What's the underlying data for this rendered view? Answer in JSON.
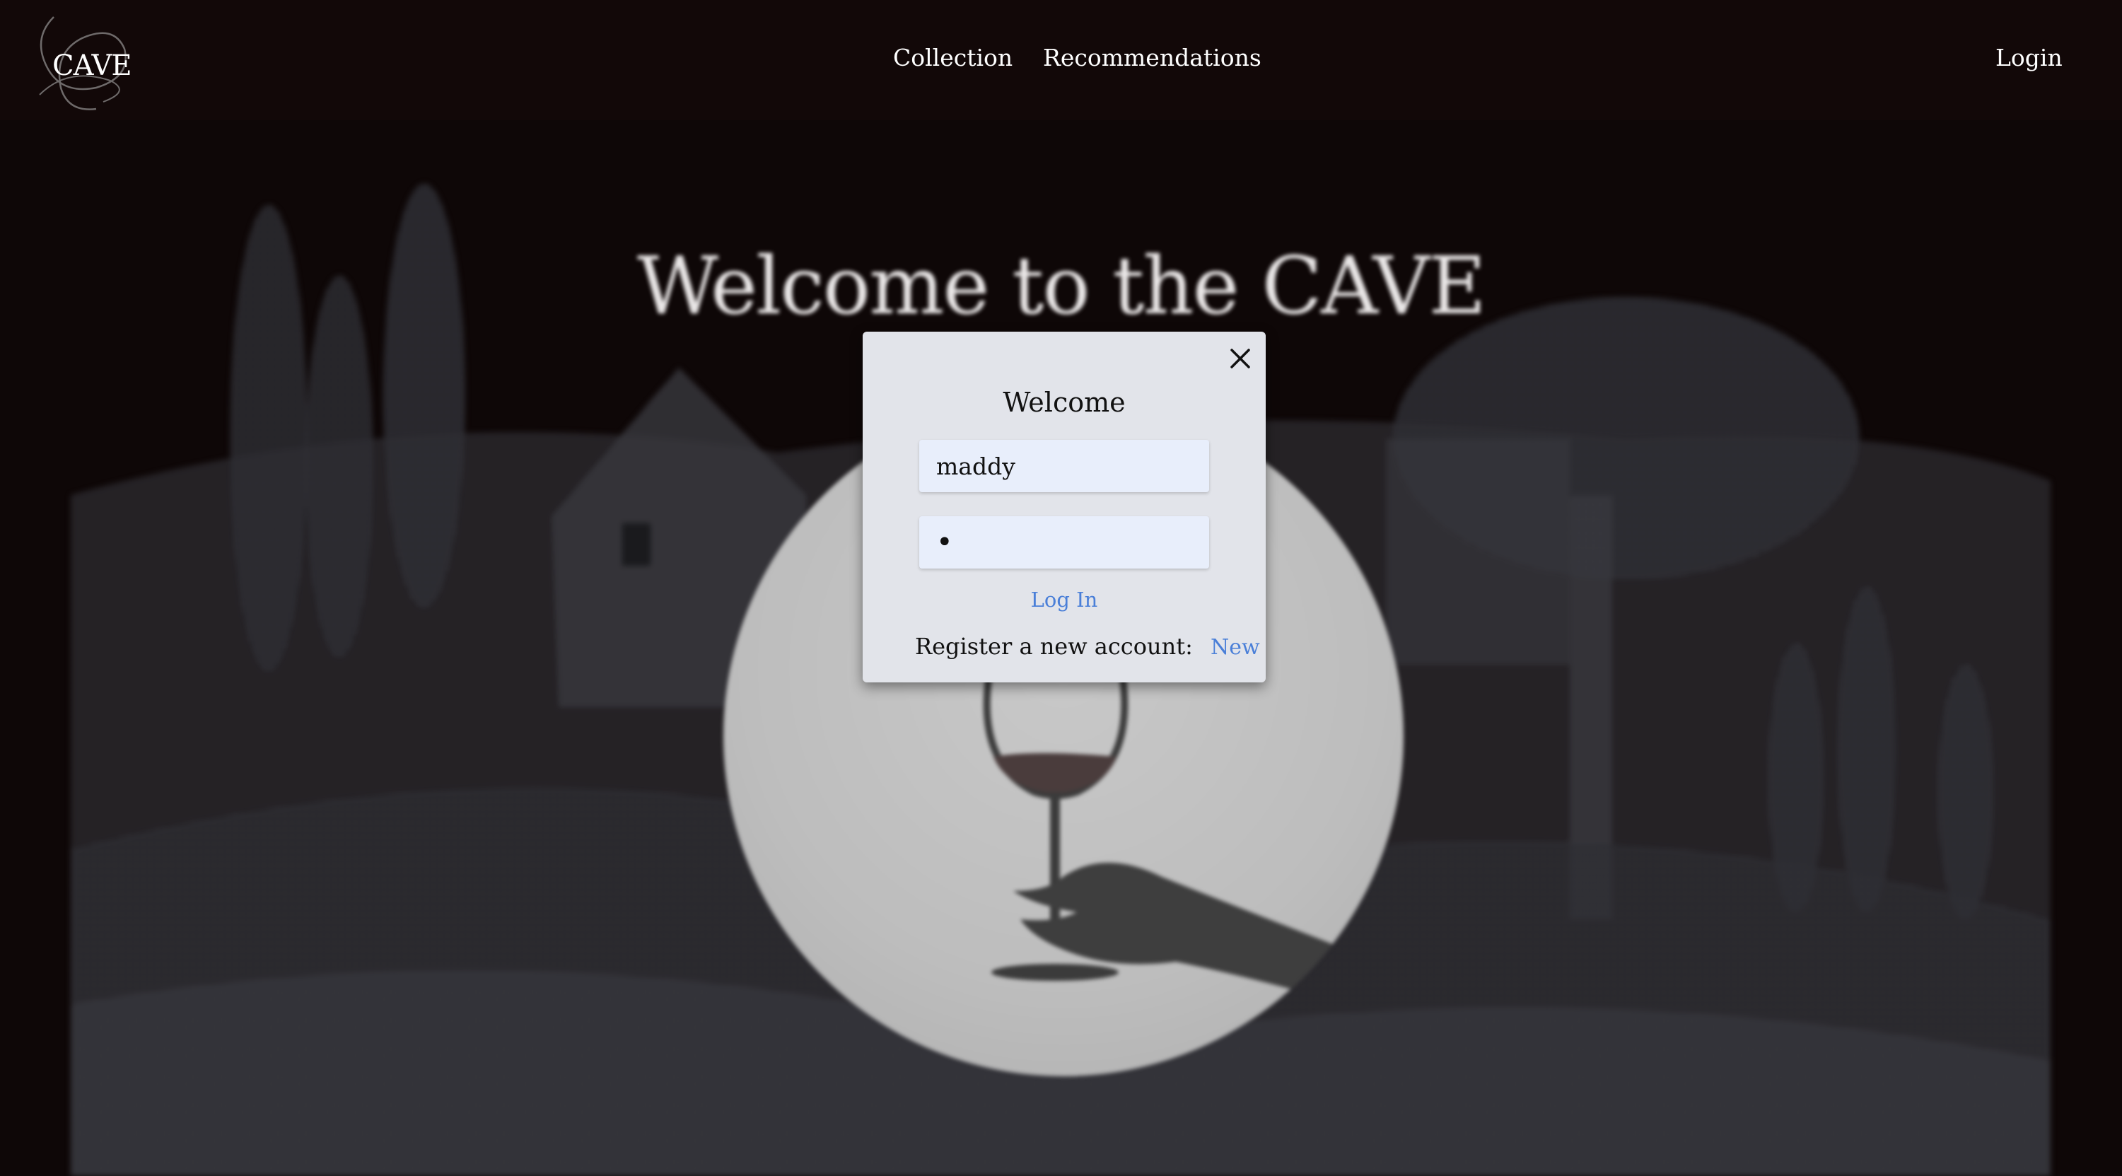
{
  "header": {
    "logo_text": "CAVE",
    "nav": {
      "collection": "Collection",
      "recommendations": "Recommendations",
      "login": "Login"
    }
  },
  "hero": {
    "title": "Welcome to the CAVE"
  },
  "modal": {
    "title": "Welcome",
    "username_value": "maddy",
    "password_value": "a",
    "login_label": "Log In",
    "register_label": "Register a new account:",
    "register_link": "New"
  },
  "colors": {
    "background": "#0e0707",
    "modal_background": "#e2e4ea",
    "input_background": "#e8eefb",
    "link": "#4a7fd8"
  },
  "icons": {
    "close": "close-icon",
    "logo_swirl": "logo-swirl-icon"
  }
}
